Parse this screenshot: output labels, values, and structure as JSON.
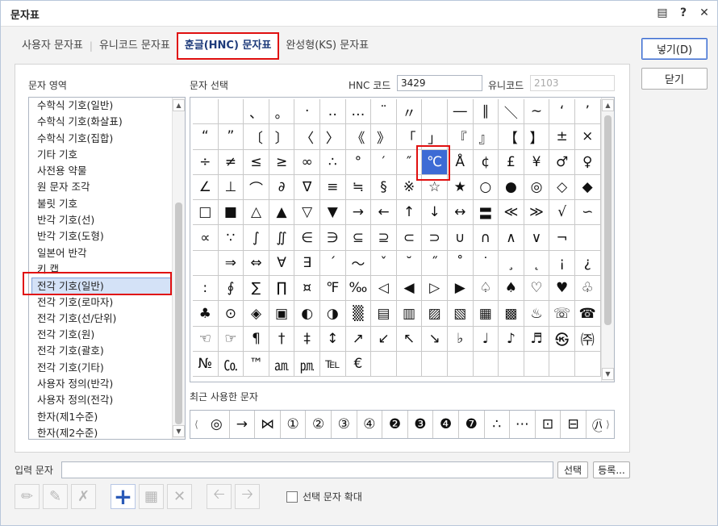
{
  "window": {
    "title": "문자표"
  },
  "titlebar_icons": [
    "chat-icon",
    "help-icon",
    "close-icon"
  ],
  "tabs": [
    {
      "label": "사용자 문자표"
    },
    {
      "label": "유니코드 문자표"
    },
    {
      "label": "훈글(HNC) 문자표",
      "active": true
    },
    {
      "label": "완성형(KS) 문자표"
    }
  ],
  "labels": {
    "area": "문자 영역",
    "select": "문자 선택",
    "hnc_code": "HNC 코드",
    "unicode": "유니코드",
    "recent": "최근 사용한 문자",
    "input": "입력 문자",
    "enlarge": "선택 문자 확대"
  },
  "codes": {
    "hnc_value": "3429",
    "unicode_value": "2103"
  },
  "area_items": [
    "수학식 기호(일반)",
    "수학식 기호(화살표)",
    "수학식 기호(집합)",
    "기타 기호",
    "사전용 약물",
    "원 문자 조각",
    "불릿 기호",
    "반각 기호(선)",
    "반각 기호(도형)",
    "일본어 반각",
    "키 캡",
    "전각 기호(일반)",
    "전각 기호(로마자)",
    "전각 기호(선/단위)",
    "전각 기호(원)",
    "전각 기호(괄호)",
    "전각 기호(기타)",
    "사용자 정의(반각)",
    "사용자 정의(전각)",
    "한자(제1수준)",
    "한자(제2수준)"
  ],
  "selected_area_index": 11,
  "grid_rows": [
    [
      "",
      "",
      "、",
      "。",
      "·",
      "‥",
      "…",
      "¨",
      "〃",
      "",
      "―",
      "∥",
      "＼",
      "∼",
      "‘",
      "’"
    ],
    [
      "“",
      "”",
      "〔",
      "〕",
      "〈",
      "〉",
      "《",
      "》",
      "「",
      "」",
      "『",
      "』",
      "【",
      "】",
      "±",
      "×"
    ],
    [
      "÷",
      "≠",
      "≤",
      "≥",
      "∞",
      "∴",
      "°",
      "′",
      "″",
      "℃",
      "Å",
      "¢",
      "£",
      "¥",
      "♂",
      "♀"
    ],
    [
      "∠",
      "⊥",
      "⌒",
      "∂",
      "∇",
      "≡",
      "≒",
      "§",
      "※",
      "☆",
      "★",
      "○",
      "●",
      "◎",
      "◇",
      "◆"
    ],
    [
      "□",
      "■",
      "△",
      "▲",
      "▽",
      "▼",
      "→",
      "←",
      "↑",
      "↓",
      "↔",
      "〓",
      "≪",
      "≫",
      "√",
      "∽"
    ],
    [
      "∝",
      "∵",
      "∫",
      "∬",
      "∈",
      "∋",
      "⊆",
      "⊇",
      "⊂",
      "⊃",
      "∪",
      "∩",
      "∧",
      "∨",
      "¬",
      ""
    ],
    [
      "",
      "⇒",
      "⇔",
      "∀",
      "∃",
      "´",
      "～",
      "ˇ",
      "˘",
      "˝",
      "˚",
      "˙",
      "¸",
      "˛",
      "¡",
      "¿"
    ],
    [
      ":",
      "∮",
      "∑",
      "∏",
      "¤",
      "℉",
      "‰",
      "◁",
      "◀",
      "▷",
      "▶",
      "♤",
      "♠",
      "♡",
      "♥",
      "♧"
    ],
    [
      "♣",
      "⊙",
      "◈",
      "▣",
      "◐",
      "◑",
      "▒",
      "▤",
      "▥",
      "▨",
      "▧",
      "▦",
      "▩",
      "♨",
      "☏",
      "☎"
    ],
    [
      "☜",
      "☞",
      "¶",
      "†",
      "‡",
      "↕",
      "↗",
      "↙",
      "↖",
      "↘",
      "♭",
      "♩",
      "♪",
      "♬",
      "㉿",
      "㈜"
    ],
    [
      "№",
      "㏇",
      "™",
      "㏂",
      "㏘",
      "℡",
      "€",
      "",
      "",
      "",
      "",
      "",
      "",
      "",
      "",
      ""
    ]
  ],
  "selected_cell": {
    "row": 2,
    "col": 9
  },
  "recent_chars": [
    "◎",
    "→",
    "⋈",
    "①",
    "②",
    "③",
    "④",
    "❷",
    "❸",
    "❹",
    "❼",
    "∴",
    "⋯",
    "⊡",
    "⊟",
    "㊇"
  ],
  "buttons": {
    "insert": "넣기(D)",
    "close": "닫기",
    "select": "선택",
    "register": "등록..."
  }
}
